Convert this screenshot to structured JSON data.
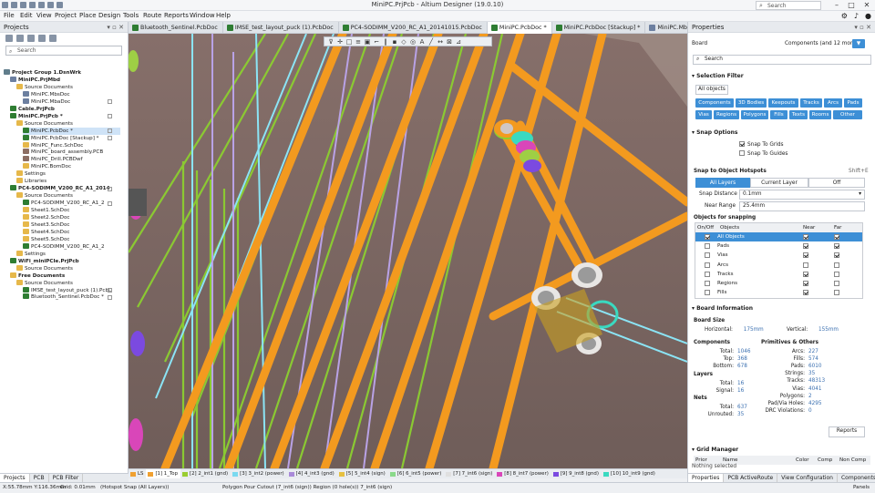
{
  "window": {
    "title": "MiniPC.PrjPcb - Altium Designer (19.0.10)",
    "search_placeholder": "Search"
  },
  "menu": [
    "File",
    "Edit",
    "View",
    "Project",
    "Place",
    "Design",
    "Tools",
    "Route",
    "Reports",
    "Window",
    "Help"
  ],
  "tabs": [
    {
      "label": "Bluetooth_Sentinel.PcbDoc",
      "color": "#2e7d32"
    },
    {
      "label": "IMSE_test_layout_puck (1).PcbDoc",
      "color": "#2e7d32"
    },
    {
      "label": "PC4-SODIMM_V200_RC_A1_20141015.PcbDoc",
      "color": "#2e7d32"
    },
    {
      "label": "MiniPC.PcbDoc *",
      "color": "#2e7d32",
      "active": true
    },
    {
      "label": "MiniPC.PcbDoc [Stackup] *",
      "color": "#2e7d32"
    },
    {
      "label": "MiniPC.MbaDoc",
      "color": "#6c7fa0"
    }
  ],
  "projects_panel": {
    "title": "Projects",
    "search_placeholder": "Search",
    "tree": [
      {
        "label": "Project Group 1.DsnWrk",
        "indent": 0,
        "bold": true,
        "icon": "#607d8b"
      },
      {
        "label": "MiniPC.PrjMbd",
        "indent": 1,
        "bold": true,
        "icon": "#6c7fa0"
      },
      {
        "label": "Source Documents",
        "indent": 2,
        "icon": "#e6b84a"
      },
      {
        "label": "MiniPC.MbsDoc",
        "indent": 3,
        "icon": "#6c7fa0"
      },
      {
        "label": "MiniPC.MbaDoc",
        "indent": 3,
        "icon": "#6c7fa0",
        "mark": true
      },
      {
        "label": "Cable.PrjPcb",
        "indent": 1,
        "bold": true,
        "icon": "#2e7d32"
      },
      {
        "label": "MiniPC.PrjPcb *",
        "indent": 1,
        "bold": true,
        "icon": "#2e7d32",
        "mark": true
      },
      {
        "label": "Source Documents",
        "indent": 2,
        "icon": "#e6b84a"
      },
      {
        "label": "MiniPC.PcbDoc *",
        "indent": 3,
        "icon": "#2e7d32",
        "sel": true,
        "mark": true
      },
      {
        "label": "MiniPC.PcbDoc [Stackup] *",
        "indent": 3,
        "icon": "#2e7d32",
        "mark": true
      },
      {
        "label": "MiniPC_Func.SchDoc",
        "indent": 3,
        "icon": "#e6b84a"
      },
      {
        "label": "MiniPC_board_assembly.PCB",
        "indent": 3,
        "icon": "#8d6e63"
      },
      {
        "label": "MiniPC_Drill.PCBDwf",
        "indent": 3,
        "icon": "#8d6e63"
      },
      {
        "label": "MiniPC.BomDoc",
        "indent": 3,
        "icon": "#e6b84a"
      },
      {
        "label": "Settings",
        "indent": 2,
        "icon": "#e6b84a"
      },
      {
        "label": "Libraries",
        "indent": 2,
        "icon": "#e6b84a"
      },
      {
        "label": "PC4-SODIMM_V200_RC_A1_2014",
        "indent": 1,
        "bold": true,
        "icon": "#2e7d32",
        "mark": true
      },
      {
        "label": "Source Documents",
        "indent": 2,
        "icon": "#e6b84a"
      },
      {
        "label": "PC4-SODIMM_V200_RC_A1_2",
        "indent": 3,
        "icon": "#2e7d32",
        "mark": true
      },
      {
        "label": "Sheet1.SchDoc",
        "indent": 3,
        "icon": "#e6b84a"
      },
      {
        "label": "Sheet2.SchDoc",
        "indent": 3,
        "icon": "#e6b84a"
      },
      {
        "label": "Sheet3.SchDoc",
        "indent": 3,
        "icon": "#e6b84a"
      },
      {
        "label": "Sheet4.SchDoc",
        "indent": 3,
        "icon": "#e6b84a"
      },
      {
        "label": "Sheet5.SchDoc",
        "indent": 3,
        "icon": "#e6b84a"
      },
      {
        "label": "PC4-SODIMM_V200_RC_A1_2",
        "indent": 3,
        "icon": "#2e7d32"
      },
      {
        "label": "Settings",
        "indent": 2,
        "icon": "#e6b84a"
      },
      {
        "label": "WiFi_miniPCIe.PrjPcb",
        "indent": 1,
        "bold": true,
        "icon": "#2e7d32"
      },
      {
        "label": "Source Documents",
        "indent": 2,
        "icon": "#e6b84a"
      },
      {
        "label": "Free Documents",
        "indent": 1,
        "bold": true,
        "icon": "#e6b84a"
      },
      {
        "label": "Source Documents",
        "indent": 2,
        "icon": "#e6b84a"
      },
      {
        "label": "IMSE_test_layout_puck (1).PcbD",
        "indent": 3,
        "icon": "#2e7d32",
        "mark": true
      },
      {
        "label": "Bluetooth_Sentinel.PcbDoc *",
        "indent": 3,
        "icon": "#2e7d32",
        "mark": true
      }
    ],
    "footer_tabs": [
      "Projects",
      "PCB",
      "PCB Filter"
    ]
  },
  "layers": [
    {
      "label": "LS",
      "color": "#f0a030"
    },
    {
      "label": "[1] 1_Top",
      "color": "#f0a030",
      "active": true
    },
    {
      "label": "[2] 2_int1 (gnd)",
      "color": "#9acd32"
    },
    {
      "label": "[3] 3_int2 (power)",
      "color": "#7ad9f0"
    },
    {
      "label": "[4] 4_int3 (gnd)",
      "color": "#a98ad9"
    },
    {
      "label": "[5] 5_int4 (sign)",
      "color": "#e6c040"
    },
    {
      "label": "[6] 6_int5 (power)",
      "color": "#8ad98a"
    },
    {
      "label": "[7] 7_int6 (sign)",
      "color": "#e0e0e0"
    },
    {
      "label": "[8] 8_int7 (power)",
      "color": "#d946b9"
    },
    {
      "label": "[9] 9_int8 (gnd)",
      "color": "#7b4ae0"
    },
    {
      "label": "[10] 10_int9 (gnd)",
      "color": "#3ad9c0"
    }
  ],
  "status": {
    "coords": "X:55.78mm Y:116.36mm",
    "grid": "Grid: 0.01mm",
    "snap": "(Hotspot Snap (All Layers))",
    "hover": "Polygon Pour Cutout (7_int6 (sign)) Region (0 hole(s)) 7_int6 (sign)",
    "right": "Panels"
  },
  "properties": {
    "title": "Properties",
    "context_label": "Board",
    "context_value": "Components (and 12 more)",
    "search_placeholder": "Search",
    "selection_filter": {
      "title": "Selection Filter",
      "all_objects": "All objects",
      "buttons": [
        "Components",
        "3D Bodies",
        "Keepouts",
        "Tracks",
        "Arcs",
        "Pads",
        "Vias",
        "Regions",
        "Polygons",
        "Fills",
        "Texts",
        "Rooms",
        "Other"
      ]
    },
    "snap_options": {
      "title": "Snap Options",
      "snap_to_grids": "Snap To Grids",
      "snap_to_guides": "Snap To Guides"
    },
    "hotspots": {
      "title": "Snap to Object Hotspots",
      "shortcut": "Shift+E",
      "seg": [
        "All Layers",
        "Current Layer",
        "Off"
      ],
      "snap_distance_label": "Snap Distance",
      "snap_distance": "0.1mm",
      "near_range_label": "Near Range",
      "near_range": "25.4mm",
      "objects_title": "Objects for snapping",
      "headers": [
        "On/Off",
        "Objects",
        "Near",
        "Far"
      ],
      "rows": [
        {
          "name": "All Objects",
          "on": true,
          "near": true,
          "far": true
        },
        {
          "name": "Pads",
          "on": false,
          "near": true,
          "far": true
        },
        {
          "name": "Vias",
          "on": false,
          "near": true,
          "far": true
        },
        {
          "name": "Arcs",
          "on": false,
          "near": false,
          "far": false
        },
        {
          "name": "Tracks",
          "on": false,
          "near": true,
          "far": false
        },
        {
          "name": "Regions",
          "on": false,
          "near": true,
          "far": false
        },
        {
          "name": "Fills",
          "on": false,
          "near": true,
          "far": false
        }
      ]
    },
    "board_info": {
      "title": "Board Information",
      "board_size": "Board Size",
      "horizontal_label": "Horizontal:",
      "horizontal": "175mm",
      "vertical_label": "Vertical:",
      "vertical": "155mm",
      "components_title": "Components",
      "components": [
        [
          "Total:",
          "1046"
        ],
        [
          "Top:",
          "368"
        ],
        [
          "Bottom:",
          "678"
        ]
      ],
      "layers_title": "Layers",
      "layers": [
        [
          "Total:",
          "16"
        ],
        [
          "Signal:",
          "16"
        ]
      ],
      "nets_title": "Nets",
      "nets": [
        [
          "Total:",
          "637"
        ],
        [
          "Unrouted:",
          "35"
        ]
      ],
      "prims_title": "Primitives & Others",
      "prims": [
        [
          "Arcs:",
          "227"
        ],
        [
          "Fills:",
          "574"
        ],
        [
          "Pads:",
          "6010"
        ],
        [
          "Strings:",
          "35"
        ],
        [
          "Tracks:",
          "48313"
        ],
        [
          "Vias:",
          "4041"
        ],
        [
          "Polygons:",
          "2"
        ],
        [
          "Pad/Via Holes:",
          "4295"
        ],
        [
          "DRC Violations:",
          "0"
        ]
      ],
      "reports_button": "Reports"
    },
    "grid_manager": {
      "title": "Grid Manager",
      "cols": [
        "Prior",
        "Name",
        "Color",
        "Comp",
        "Non Comp"
      ]
    },
    "nothing_selected": "Nothing selected",
    "footer_tabs": [
      "Properties",
      "PCB ActiveRoute",
      "View Configuration",
      "Components"
    ]
  }
}
